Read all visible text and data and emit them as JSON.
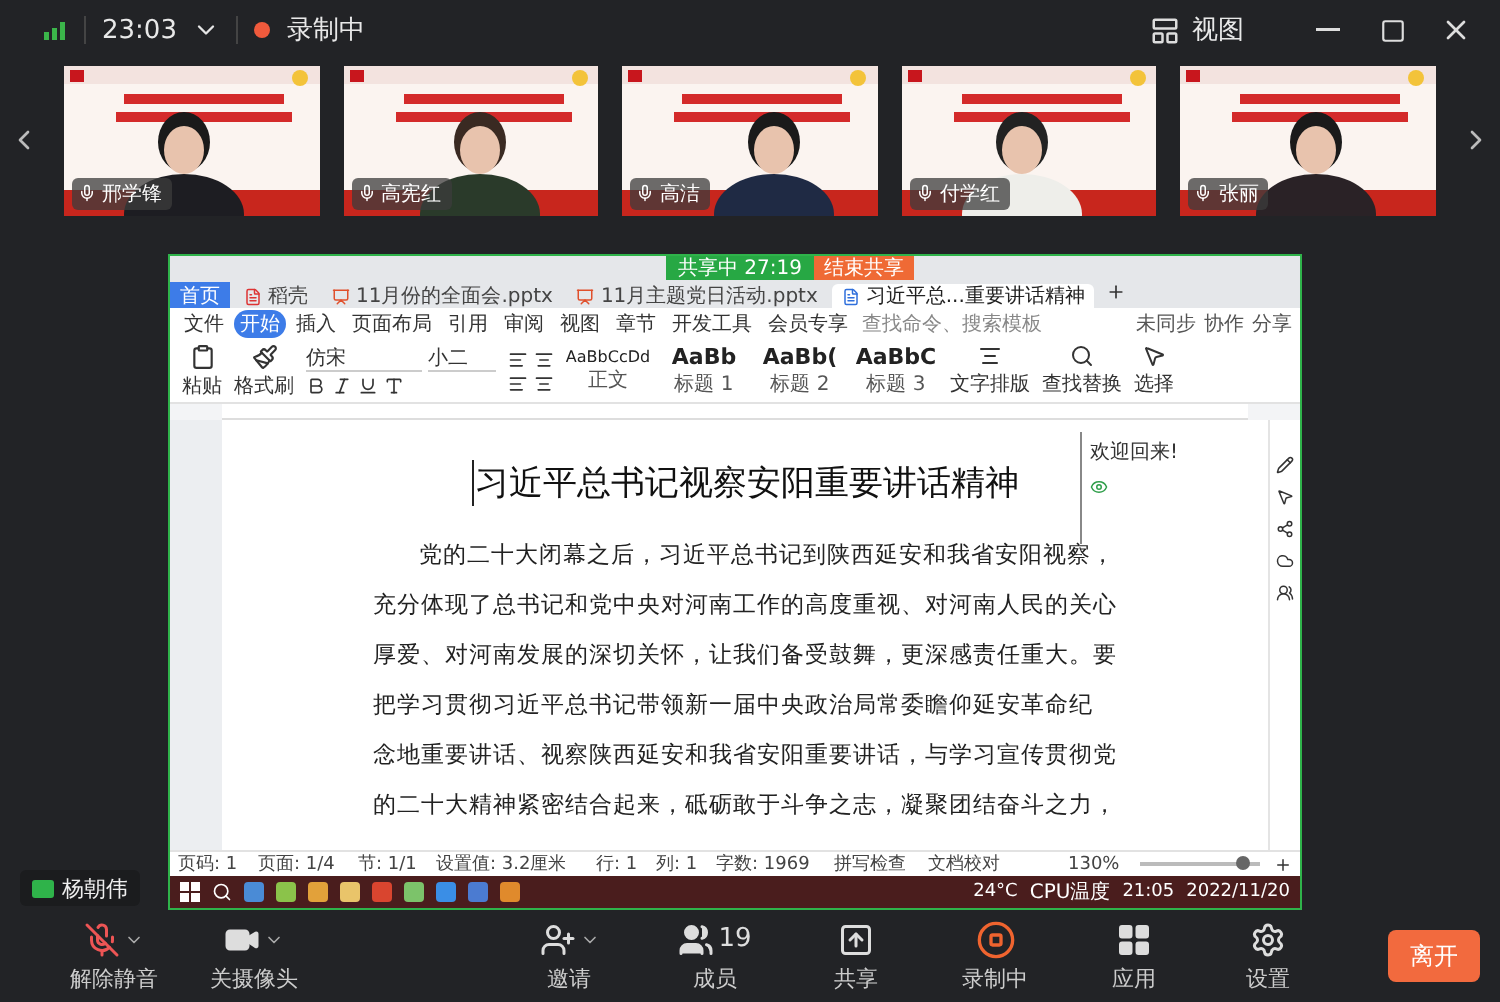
{
  "top_bar": {
    "time": "23:03",
    "recording": "录制中",
    "view": "视图"
  },
  "video_tiles": [
    {
      "name": "邢学锋"
    },
    {
      "name": "高宪红"
    },
    {
      "name": "高洁"
    },
    {
      "name": "付学红"
    },
    {
      "name": "张丽"
    }
  ],
  "shared_screen": {
    "share_timer": "共享中 27:19",
    "stop_share": "结束共享",
    "tabs": [
      {
        "label": "首页",
        "selected": false,
        "kind": "home"
      },
      {
        "label": "稻壳",
        "selected": false,
        "kind": "shell"
      },
      {
        "label": "11月份的全面会.pptx",
        "selected": false,
        "kind": "ppt"
      },
      {
        "label": "11月主题党日活动.pptx",
        "selected": false,
        "kind": "ppt"
      },
      {
        "label": "习近平总...重要讲话精神",
        "selected": true,
        "kind": "doc"
      }
    ],
    "menu": [
      {
        "label": "文件",
        "selected": false
      },
      {
        "label": "开始",
        "selected": true
      },
      {
        "label": "插入",
        "selected": false
      },
      {
        "label": "页面布局",
        "selected": false
      },
      {
        "label": "引用",
        "selected": false
      },
      {
        "label": "审阅",
        "selected": false
      },
      {
        "label": "视图",
        "selected": false
      },
      {
        "label": "章节",
        "selected": false
      },
      {
        "label": "开发工具",
        "selected": false
      },
      {
        "label": "会员专享",
        "selected": false
      }
    ],
    "command_search": {
      "placeholder": "查找命令、搜索模板"
    },
    "menu_right": [
      "未同步",
      "协作",
      "分享"
    ],
    "ribbon": {
      "paste": "粘贴",
      "format_painter": "格式刷",
      "font": "仿宋",
      "size": "小二",
      "styles": [
        {
          "sample": "AaBbCcDd",
          "label": "正文"
        },
        {
          "sample": "AaBb",
          "label": "标题 1"
        },
        {
          "sample": "AaBb(",
          "label": "标题 2"
        },
        {
          "sample": "AaBbC",
          "label": "标题 3"
        }
      ],
      "tools": [
        "文字排版",
        "查找替换",
        "选择"
      ]
    },
    "document": {
      "title": "习近平总书记视察安阳重要讲话精神",
      "paragraph_lines": [
        "党的二十大闭幕之后，习近平总书记到陕西延安和我省安阳视察，",
        "充分体现了总书记和党中央对河南工作的高度重视、对河南人民的关心",
        "厚爱、对河南发展的深切关怀，让我们备受鼓舞，更深感责任重大。要",
        "把学习贯彻习近平总书记带领新一届中央政治局常委瞻仰延安革命纪",
        "念地重要讲话、视察陕西延安和我省安阳重要讲话，与学习宣传贯彻党",
        "的二十大精神紧密结合起来，砥砺敢于斗争之志，凝聚团结奋斗之力，"
      ]
    },
    "side_panel": {
      "title": "欢迎回来!"
    },
    "status_bar": [
      "页码: 1",
      "页面: 1/4",
      "节: 1/1",
      "设置值: 3.2厘米",
      "行: 1",
      "列: 1",
      "字数: 1969",
      "拼写检查",
      "文档校对"
    ],
    "zoom": {
      "value": "130%",
      "level": 0.85
    },
    "taskbar": {
      "temperature": "24°C",
      "temperature_label": "CPU温度",
      "time": "21:05",
      "date": "2022/11/20"
    }
  },
  "speaker": {
    "name": "杨朝伟"
  },
  "toolbar": [
    {
      "kind": "mic-off",
      "label": "解除静音"
    },
    {
      "kind": "camera",
      "label": "关摄像头"
    },
    {
      "kind": "invite",
      "label": "邀请"
    },
    {
      "kind": "members",
      "label": "成员",
      "count": "19"
    },
    {
      "kind": "share",
      "label": "共享"
    },
    {
      "kind": "record",
      "label": "录制中"
    },
    {
      "kind": "apps",
      "label": "应用"
    },
    {
      "kind": "settings",
      "label": "设置"
    }
  ],
  "leave": "离开"
}
